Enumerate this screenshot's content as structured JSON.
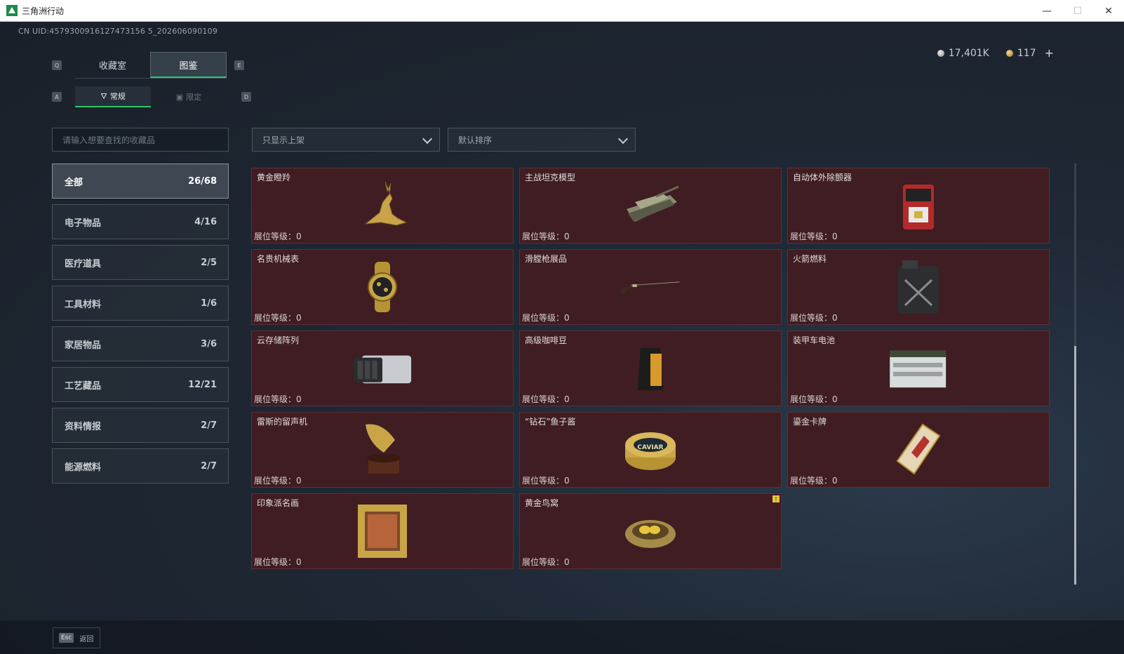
{
  "window": {
    "title": "三角洲行动",
    "minimize": "—",
    "maximize": "☐",
    "close": "✕"
  },
  "uid": "CN UID:4579300916127473156 5_202606090109",
  "currency": {
    "silver": "17,401K",
    "gold": "117",
    "plus": "+"
  },
  "keys": {
    "prev_tab": "Q",
    "next_tab": "E",
    "prev_sub": "A",
    "next_sub": "D",
    "esc": "Esc"
  },
  "tabs": [
    {
      "label": "收藏室",
      "active": false
    },
    {
      "label": "图鉴",
      "active": true
    }
  ],
  "subtabs": [
    {
      "label": "常规",
      "icon": "bottle-icon",
      "active": true
    },
    {
      "label": "限定",
      "icon": "image-icon",
      "active": false
    }
  ],
  "search": {
    "placeholder": "请输入想要查找的收藏品"
  },
  "filters": {
    "show_label": "只显示上架",
    "sort_label": "默认排序"
  },
  "categories": [
    {
      "label": "全部",
      "count": "26/68",
      "active": true
    },
    {
      "label": "电子物品",
      "count": "4/16"
    },
    {
      "label": "医疗道具",
      "count": "2/5"
    },
    {
      "label": "工具材料",
      "count": "1/6"
    },
    {
      "label": "家居物品",
      "count": "3/6"
    },
    {
      "label": "工艺藏品",
      "count": "12/21"
    },
    {
      "label": "资料情报",
      "count": "2/7"
    },
    {
      "label": "能源燃料",
      "count": "2/7"
    }
  ],
  "level_label": "展位等级：",
  "items": [
    {
      "name": "",
      "level": "0",
      "icon": "item-icon"
    },
    {
      "name": "",
      "level": "0",
      "icon": "item-icon"
    },
    {
      "name": "",
      "level": "0",
      "icon": "item-icon"
    },
    {
      "name": "黄金瞪羚",
      "level": "0",
      "icon": "gazelle-icon"
    },
    {
      "name": "主战坦克模型",
      "level": "0",
      "icon": "tank-icon"
    },
    {
      "name": "自动体外除颤器",
      "level": "0",
      "icon": "defibrillator-icon"
    },
    {
      "name": "名贵机械表",
      "level": "0",
      "icon": "watch-icon"
    },
    {
      "name": "滑膛枪展品",
      "level": "0",
      "icon": "musket-icon"
    },
    {
      "name": "火箭燃料",
      "level": "0",
      "icon": "fuel-can-icon"
    },
    {
      "name": "云存储阵列",
      "level": "0",
      "icon": "storage-array-icon"
    },
    {
      "name": "高级咖啡豆",
      "level": "0",
      "icon": "coffee-bag-icon"
    },
    {
      "name": "装甲车电池",
      "level": "0",
      "icon": "battery-icon"
    },
    {
      "name": "雷斯的留声机",
      "level": "0",
      "icon": "gramophone-icon"
    },
    {
      "name": "“钻石”鱼子酱",
      "level": "0",
      "icon": "caviar-tin-icon",
      "tin_text": "CAVIAR"
    },
    {
      "name": "鎏金卡牌",
      "level": "0",
      "icon": "card-icon"
    },
    {
      "name": "印象派名画",
      "level": "0",
      "icon": "painting-icon"
    },
    {
      "name": "黄金鸟窝",
      "level": "0",
      "icon": "nest-icon",
      "badge": "!"
    }
  ],
  "back_label": "返回",
  "colors": {
    "accent": "#27c96a",
    "card_bg": "#3f1d22",
    "badge": "#e8c43c"
  }
}
